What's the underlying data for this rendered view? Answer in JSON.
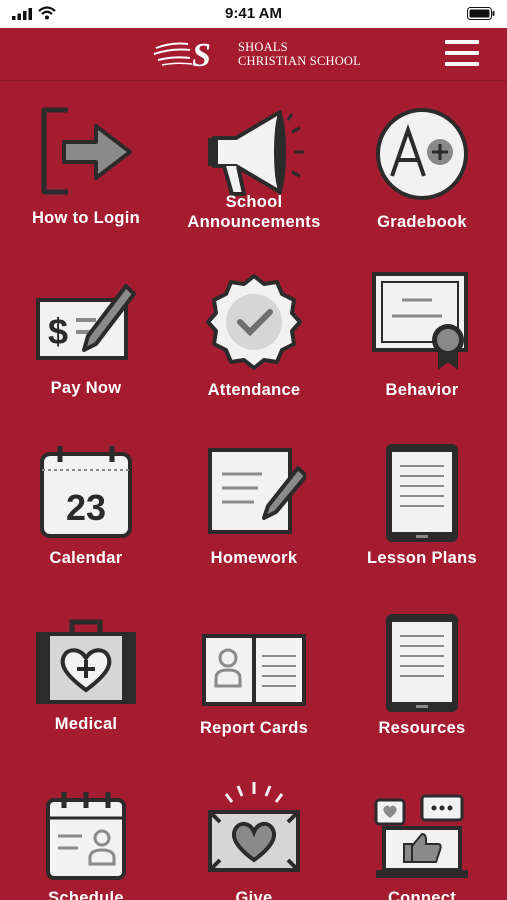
{
  "status_bar": {
    "time": "9:41 AM"
  },
  "header": {
    "school_name_line1": "SHOALS",
    "school_name_line2": "CHRISTIAN SCHOOL",
    "logo_letter": "S"
  },
  "colors": {
    "background": "#a51c30",
    "icon_fill": "#f2f2f2",
    "icon_stroke": "#2b2b2b",
    "icon_mid": "#8a8a8a"
  },
  "tiles": [
    {
      "label": "How to Login",
      "icon": "login-arrow-icon"
    },
    {
      "label": "School Announcements",
      "icon": "megaphone-icon"
    },
    {
      "label": "Gradebook",
      "icon": "a-plus-grade-icon"
    },
    {
      "label": "Pay Now",
      "icon": "payment-check-icon"
    },
    {
      "label": "Attendance",
      "icon": "checkmark-badge-icon"
    },
    {
      "label": "Behavior",
      "icon": "certificate-icon"
    },
    {
      "label": "Calendar",
      "icon": "calendar-icon",
      "date": "23"
    },
    {
      "label": "Homework",
      "icon": "notepad-pencil-icon"
    },
    {
      "label": "Lesson Plans",
      "icon": "tablet-icon"
    },
    {
      "label": "Medical",
      "icon": "medical-kit-icon"
    },
    {
      "label": "Report Cards",
      "icon": "report-card-icon"
    },
    {
      "label": "Resources",
      "icon": "tablet-icon"
    },
    {
      "label": "Schedule",
      "icon": "schedule-icon"
    },
    {
      "label": "Give",
      "icon": "donation-heart-icon"
    },
    {
      "label": "Connect",
      "icon": "social-connect-icon"
    }
  ]
}
